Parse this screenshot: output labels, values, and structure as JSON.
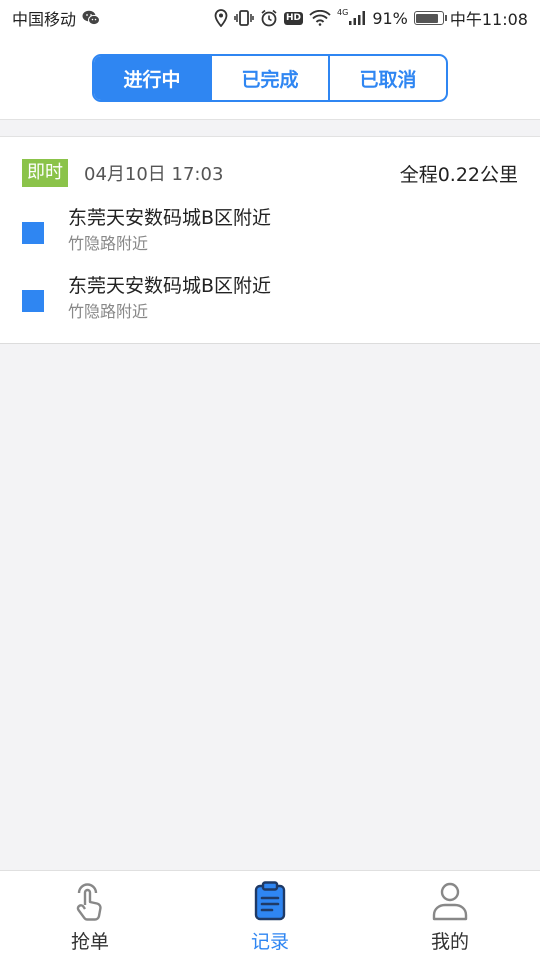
{
  "status_bar": {
    "carrier": "中国移动",
    "network": "4G",
    "battery": "91%",
    "battery_level": 0.91,
    "time": "中午11:08",
    "hd_label": "HD",
    "icons": [
      "wechat-icon",
      "location-icon",
      "vibrate-icon",
      "alarm-icon",
      "hd-icon",
      "wifi-icon",
      "signal-icon",
      "battery-icon"
    ]
  },
  "tabs": [
    {
      "label": "进行中",
      "active": true
    },
    {
      "label": "已完成",
      "active": false
    },
    {
      "label": "已取消",
      "active": false
    }
  ],
  "orders": [
    {
      "tag": "即时",
      "time": "04月10日 17:03",
      "distance": "全程0.22公里",
      "stops": [
        {
          "main": "东莞天安数码城B区附近",
          "sub": "竹隐路附近"
        },
        {
          "main": "东莞天安数码城B区附近",
          "sub": "竹隐路附近"
        }
      ]
    }
  ],
  "bottom_nav": [
    {
      "label": "抢单",
      "icon": "tap-hand-icon",
      "active": false
    },
    {
      "label": "记录",
      "icon": "clipboard-icon",
      "active": true
    },
    {
      "label": "我的",
      "icon": "user-icon",
      "active": false
    }
  ],
  "colors": {
    "accent": "#2f86f2",
    "instant_tag": "#8bc34a",
    "background": "#f3f3f5"
  }
}
